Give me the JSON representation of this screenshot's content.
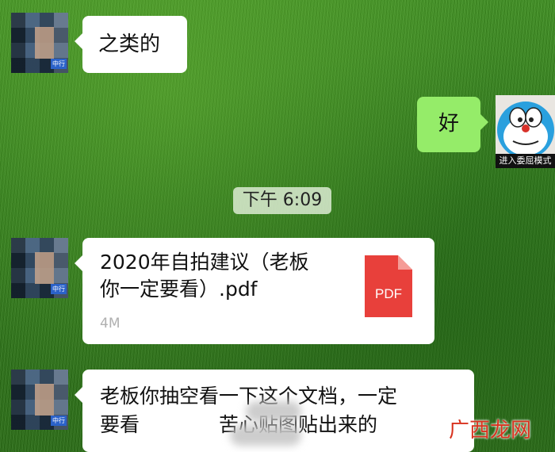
{
  "messages": [
    {
      "side": "left",
      "text": "之类的"
    },
    {
      "side": "right",
      "text": "好"
    },
    {
      "side": "left",
      "type": "file",
      "file_name_line1": "2020年自拍建议（老板",
      "file_name_line2": "你一定要看）.pdf",
      "file_size": "4M",
      "file_icon": "pdf-icon",
      "file_icon_label": "PDF"
    },
    {
      "side": "left",
      "line1": "老板你抽空看一下这个文档，一定",
      "line2_prefix": "要看",
      "line2_suffix": "苦心贴图贴出来的"
    }
  ],
  "timestamp": "下午 6:09",
  "self_avatar_caption": "进入委屈模式",
  "contact_avatar_tag": "中行",
  "watermark": "广西龙网",
  "colors": {
    "incoming_bubble": "#ffffff",
    "outgoing_bubble": "#95ec69",
    "pdf_red": "#e8403b",
    "watermark": "#d8321e"
  }
}
